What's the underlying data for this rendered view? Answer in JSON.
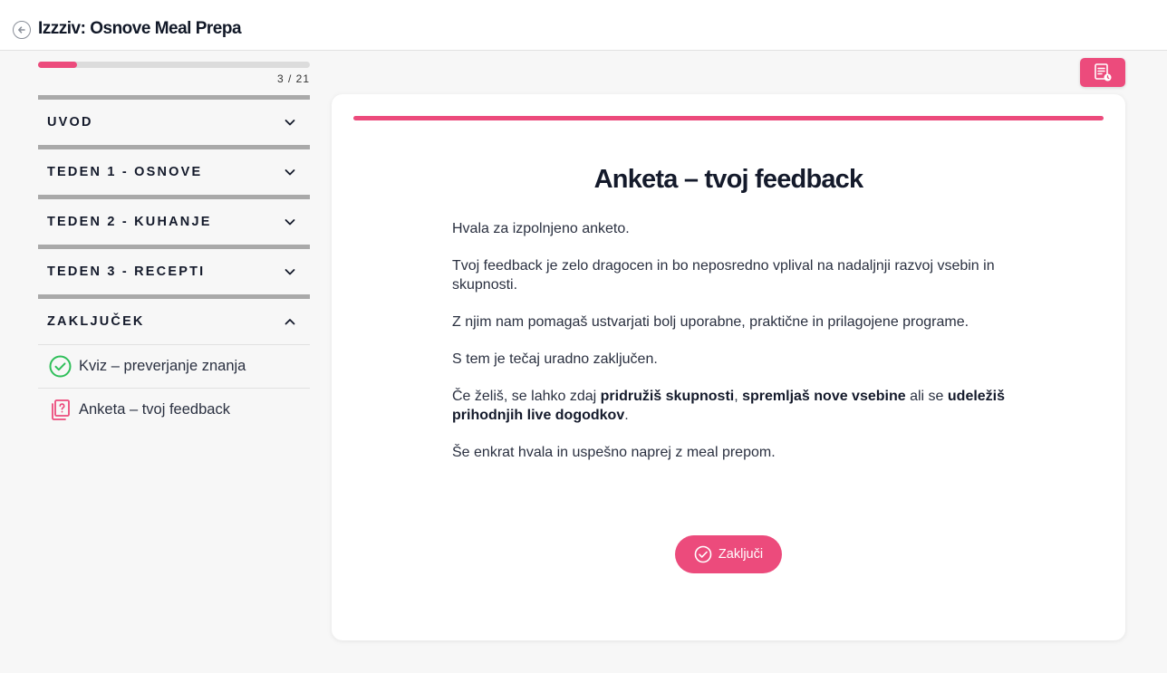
{
  "header": {
    "title": "Izzziv: Osnove Meal Prepa"
  },
  "progress": {
    "count_label": "3 / 21",
    "fraction": 0.143
  },
  "sidebar": {
    "sections": [
      {
        "title": "UVOD",
        "expanded": false
      },
      {
        "title": "TEDEN 1 - OSNOVE",
        "expanded": false
      },
      {
        "title": "TEDEN 2 - KUHANJE",
        "expanded": false
      },
      {
        "title": "TEDEN 3 - RECEPTI",
        "expanded": false
      },
      {
        "title": "ZAKLJUČEK",
        "expanded": true
      }
    ],
    "items": [
      {
        "label": "Kviz – preverjanje znanja",
        "icon": "check-circle-icon"
      },
      {
        "label": "Anketa – tvoj feedback",
        "icon": "survey-icon"
      }
    ]
  },
  "lesson": {
    "title": "Anketa – tvoj feedback",
    "p1": "Hvala za izpolnjeno anketo.",
    "p2": "Tvoj feedback je zelo dragocen in bo neposredno vplival na nadaljnji razvoj vsebin in skupnosti.",
    "p3": "Z njim nam pomagaš ustvarjati bolj uporabne, praktične in prilagojene programe.",
    "p4": "S tem je tečaj uradno zaključen.",
    "p5_a": "Če želiš, se lahko zdaj ",
    "p5_b": "pridružiš skupnosti",
    "p5_c": ", ",
    "p5_d": "spremljaš nove vsebine",
    "p5_e": " ali se ",
    "p5_f": "udeležiš prihodnjih live dogodkov",
    "p5_g": ".",
    "p6": "Še enkrat hvala in uspešno naprej z meal prepom.",
    "finish_label": "Zaključi"
  },
  "colors": {
    "accent": "#ec4b7c",
    "success": "#2fbf5a",
    "divider": "#a9a9a9"
  }
}
